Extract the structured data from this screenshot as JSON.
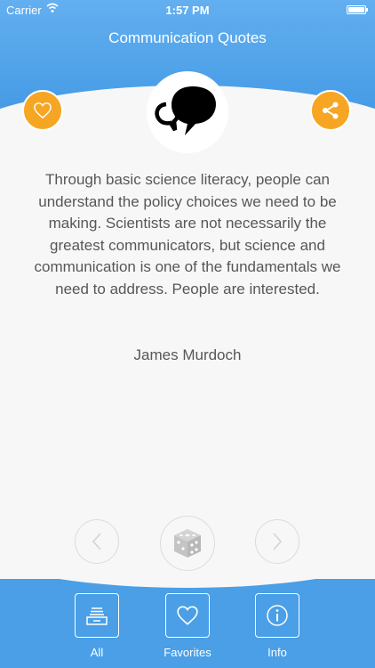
{
  "status_bar": {
    "carrier": "Carrier",
    "time": "1:57 PM",
    "battery": 1.0
  },
  "header": {
    "title": "Communication Quotes"
  },
  "quote": {
    "text": "Through basic science literacy, people can understand the policy choices we need to be making. Scientists are not necessarily the greatest communicators, but science and communication is one of the fundamentals we need to address. People are interested.",
    "author": "James Murdoch"
  },
  "actions": {
    "favorite_icon": "heart-outline-icon",
    "share_icon": "share-icon",
    "logo_icon": "speech-bubbles-icon"
  },
  "navigation": {
    "prev_icon": "chevron-left-icon",
    "random_icon": "dice-icon",
    "next_icon": "chevron-right-icon"
  },
  "tabs": [
    {
      "label": "All",
      "icon": "stack-icon"
    },
    {
      "label": "Favorites",
      "icon": "heart-icon"
    },
    {
      "label": "Info",
      "icon": "info-icon"
    }
  ],
  "colors": {
    "header_blue": "#4a9fe6",
    "accent_orange": "#f6a623",
    "text_gray": "#575757",
    "background": "#f7f7f7"
  }
}
